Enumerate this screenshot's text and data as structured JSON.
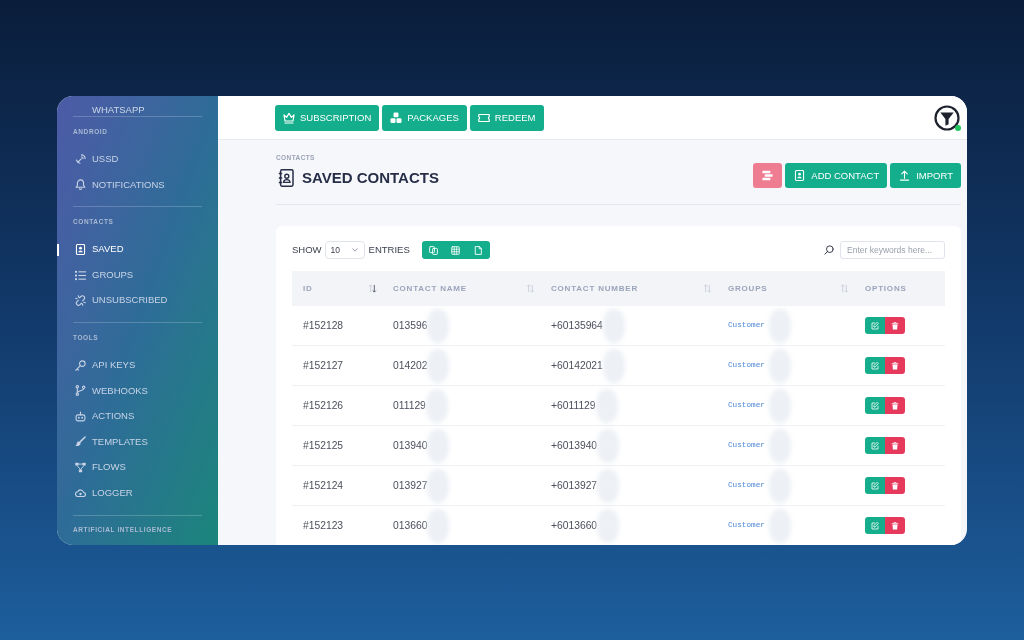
{
  "sidebar": {
    "top_item": "WHATSAPP",
    "sections": [
      {
        "title": "ANDROID",
        "items": [
          {
            "label": "USSD",
            "selected": false
          },
          {
            "label": "NOTIFICATIONS",
            "selected": false
          }
        ]
      },
      {
        "title": "CONTACTS",
        "items": [
          {
            "label": "SAVED",
            "selected": true
          },
          {
            "label": "GROUPS",
            "selected": false
          },
          {
            "label": "UNSUBSCRIBED",
            "selected": false
          }
        ]
      },
      {
        "title": "TOOLS",
        "items": [
          {
            "label": "API KEYS",
            "selected": false
          },
          {
            "label": "WEBHOOKS",
            "selected": false
          },
          {
            "label": "ACTIONS",
            "selected": false
          },
          {
            "label": "TEMPLATES",
            "selected": false
          },
          {
            "label": "FLOWS",
            "selected": false
          },
          {
            "label": "LOGGER",
            "selected": false
          }
        ]
      },
      {
        "title": "ARTIFICIAL INTELLIGENCE"
      }
    ]
  },
  "top_bar": {
    "buttons": [
      {
        "label": "SUBSCRIPTION"
      },
      {
        "label": "PACKAGES"
      },
      {
        "label": "REDEEM"
      }
    ],
    "avatar": {
      "online": true
    }
  },
  "page": {
    "breadcrumb": "CONTACTS",
    "title": "SAVED CONTACTS",
    "actions": [
      {
        "kind": "danger"
      },
      {
        "kind": "primary",
        "label": "ADD CONTACT"
      },
      {
        "kind": "primary",
        "label": "IMPORT"
      }
    ]
  },
  "table": {
    "show_label": "SHOW",
    "page_size": "10",
    "entries_label": "ENTRIES",
    "search": {
      "placeholder": "Enter keywords here..."
    },
    "columns": [
      {
        "label": "ID",
        "sorted": true
      },
      {
        "label": "CONTACT NAME",
        "sorted": false
      },
      {
        "label": "CONTACT NUMBER",
        "sorted": false
      },
      {
        "label": "GROUPS",
        "sorted": false
      },
      {
        "label": "OPTIONS"
      }
    ],
    "rows": [
      {
        "id": "#152128",
        "name": "013596",
        "number": "+60135964",
        "group": "Customer",
        "redacted": true
      },
      {
        "id": "#152127",
        "name": "014202",
        "number": "+60142021",
        "group": "Customer",
        "redacted": true
      },
      {
        "id": "#152126",
        "name": "011129",
        "number": "+6011129",
        "group": "Customer",
        "redacted": true
      },
      {
        "id": "#152125",
        "name": "013940",
        "number": "+6013940",
        "group": "Customer",
        "redacted": true
      },
      {
        "id": "#152124",
        "name": "013927",
        "number": "+6013927",
        "group": "Customer",
        "redacted": true
      },
      {
        "id": "#152123",
        "name": "013660",
        "number": "+6013660",
        "group": "Customer",
        "redacted": true
      }
    ]
  }
}
